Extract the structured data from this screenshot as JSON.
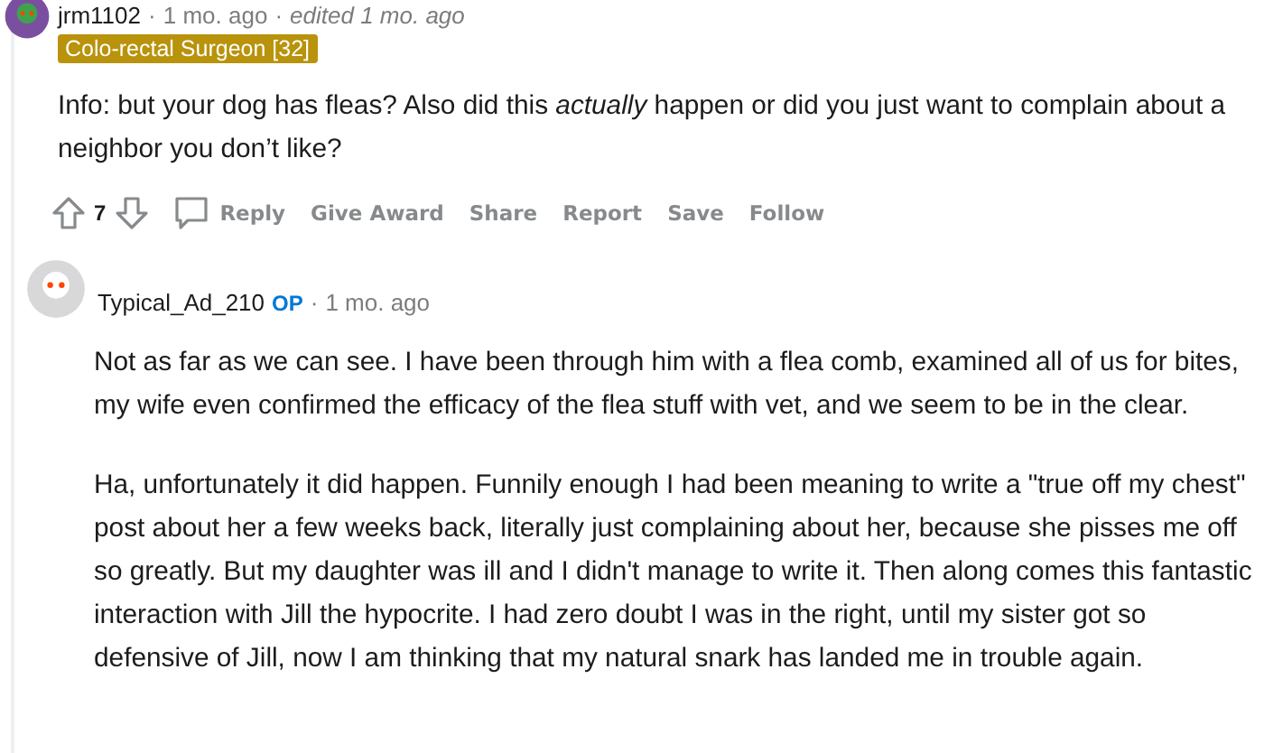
{
  "comments": [
    {
      "author": "jrm1102",
      "separator": "·",
      "time": "1 mo. ago",
      "edited": "edited 1 mo. ago",
      "flair": "Colo-rectal Surgeon [32]",
      "paragraphs": [
        "Info: but your dog has fleas? Also did this *actually* happen or did you just want to complain about a neighbor you don’t like?"
      ],
      "score": "7",
      "actions": [
        "Reply",
        "Give Award",
        "Share",
        "Report",
        "Save",
        "Follow"
      ]
    },
    {
      "author": "Typical_Ad_210",
      "op_label": "OP",
      "separator": "·",
      "time": "1 mo. ago",
      "paragraphs": [
        "Not as far as we can see. I have been through him with a flea comb, examined all of us for bites, my wife even confirmed the efficacy of the flea stuff with vet, and we seem to be in the clear.",
        "Ha, unfortunately it did happen. Funnily enough I had been meaning to write a \"true off my chest\" post about her a few weeks back, literally just complaining about her, because she pisses me off so greatly. But my daughter was ill and I didn't manage to write it. Then along comes this fantastic interaction with Jill the hypocrite. I had zero doubt I was in the right, until my sister got so defensive of Jill, now I am thinking that my natural snark has landed me in trouble again."
      ]
    }
  ]
}
